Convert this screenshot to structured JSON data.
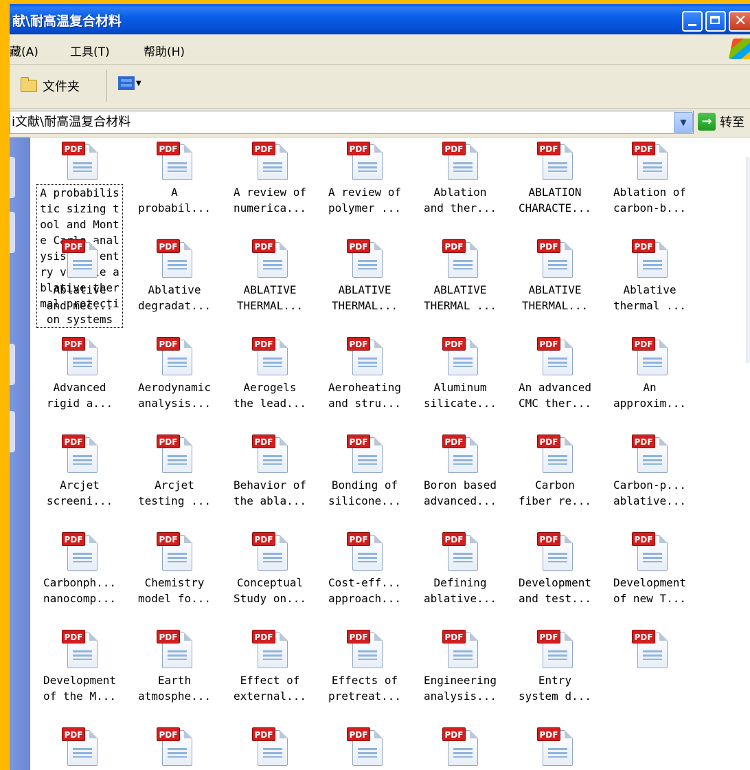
{
  "window": {
    "title": "献\\耐高温复合材料",
    "colors": {
      "title_bar": "#0b5fe8",
      "desktop_border": "#ffb900",
      "chrome": "#ece9d8",
      "pdf_badge": "#d21e1e"
    }
  },
  "menu": {
    "favorites": "藏(A)",
    "tools": "工具(T)",
    "help": "帮助(H)"
  },
  "toolbar": {
    "folders_label": "文件夹",
    "views_icon": "views-icon"
  },
  "address": {
    "path": "i文献\\耐高温复合材料",
    "go_label": "转至"
  },
  "files": [
    {
      "icon": "pdf-icon",
      "label": "A probabilistic sizing tool and Monte Carlo analysis for entry vehicle ablative thermal protection systems",
      "selected": true
    },
    {
      "icon": "pdf-icon",
      "label": "A\nprobabil..."
    },
    {
      "icon": "pdf-icon",
      "label": "A review of\nnumerica..."
    },
    {
      "icon": "pdf-icon",
      "label": "A review of\npolymer ..."
    },
    {
      "icon": "pdf-icon",
      "label": "Ablation\nand ther..."
    },
    {
      "icon": "pdf-icon",
      "label": "ABLATION\nCHARACTE..."
    },
    {
      "icon": "pdf-icon",
      "label": "Ablation of\ncarbon-b..."
    },
    {
      "icon": "pdf-icon",
      "label": "Ablative\nand mec..."
    },
    {
      "icon": "pdf-icon",
      "label": "Ablative\ndegradat..."
    },
    {
      "icon": "pdf-icon",
      "label": "ABLATIVE\nTHERMAL..."
    },
    {
      "icon": "pdf-icon",
      "label": "ABLATIVE\nTHERMAL..."
    },
    {
      "icon": "pdf-icon",
      "label": "ABLATIVE\nTHERMAL ..."
    },
    {
      "icon": "pdf-icon",
      "label": "ABLATIVE\nTHERMAL..."
    },
    {
      "icon": "pdf-icon",
      "label": "Ablative\nthermal ..."
    },
    {
      "icon": "pdf-icon",
      "label": "Advanced\nrigid a..."
    },
    {
      "icon": "pdf-icon",
      "label": "Aerodynamic\nanalysis..."
    },
    {
      "icon": "pdf-icon",
      "label": "Aerogels\nthe lead..."
    },
    {
      "icon": "pdf-icon",
      "label": "Aeroheating\nand stru..."
    },
    {
      "icon": "pdf-icon",
      "label": "Aluminum\nsilicate..."
    },
    {
      "icon": "pdf-icon",
      "label": "An advanced\nCMC ther..."
    },
    {
      "icon": "pdf-icon",
      "label": "An\napproxim..."
    },
    {
      "icon": "pdf-icon",
      "label": "Arcjet\nscreeni..."
    },
    {
      "icon": "pdf-icon",
      "label": "Arcjet\ntesting ..."
    },
    {
      "icon": "pdf-icon",
      "label": "Behavior of\nthe abla..."
    },
    {
      "icon": "pdf-icon",
      "label": "Bonding of\nsilicone..."
    },
    {
      "icon": "pdf-icon",
      "label": "Boron based\nadvanced..."
    },
    {
      "icon": "pdf-icon",
      "label": "Carbon\nfiber re..."
    },
    {
      "icon": "pdf-icon",
      "label": "Carbon-p...\nablative..."
    },
    {
      "icon": "pdf-icon",
      "label": "Carbonph...\nnanocomp..."
    },
    {
      "icon": "pdf-icon",
      "label": "Chemistry\nmodel fo..."
    },
    {
      "icon": "pdf-icon",
      "label": "Conceptual\nStudy on..."
    },
    {
      "icon": "pdf-icon",
      "label": "Cost-eff...\napproach..."
    },
    {
      "icon": "pdf-icon",
      "label": "Defining\nablative..."
    },
    {
      "icon": "pdf-icon",
      "label": "Development\nand test..."
    },
    {
      "icon": "pdf-icon",
      "label": "Development\nof new T..."
    },
    {
      "icon": "pdf-icon",
      "label": "Development\nof the M..."
    },
    {
      "icon": "pdf-icon",
      "label": "Earth\natmosphe..."
    },
    {
      "icon": "pdf-icon",
      "label": "Effect of\nexternal..."
    },
    {
      "icon": "pdf-icon",
      "label": "Effects of\npretreat..."
    },
    {
      "icon": "pdf-icon",
      "label": "Engineering\nanalysis..."
    },
    {
      "icon": "pdf-icon",
      "label": "Entry\nsystem d..."
    },
    {
      "icon": "pdf-icon",
      "label": ""
    },
    {
      "icon": "pdf-icon",
      "label": ""
    },
    {
      "icon": "pdf-icon",
      "label": ""
    },
    {
      "icon": "pdf-icon",
      "label": ""
    },
    {
      "icon": "pdf-icon",
      "label": ""
    },
    {
      "icon": "pdf-icon",
      "label": ""
    },
    {
      "icon": "pdf-icon",
      "label": ""
    }
  ],
  "pdf_badge_text": "PDF"
}
